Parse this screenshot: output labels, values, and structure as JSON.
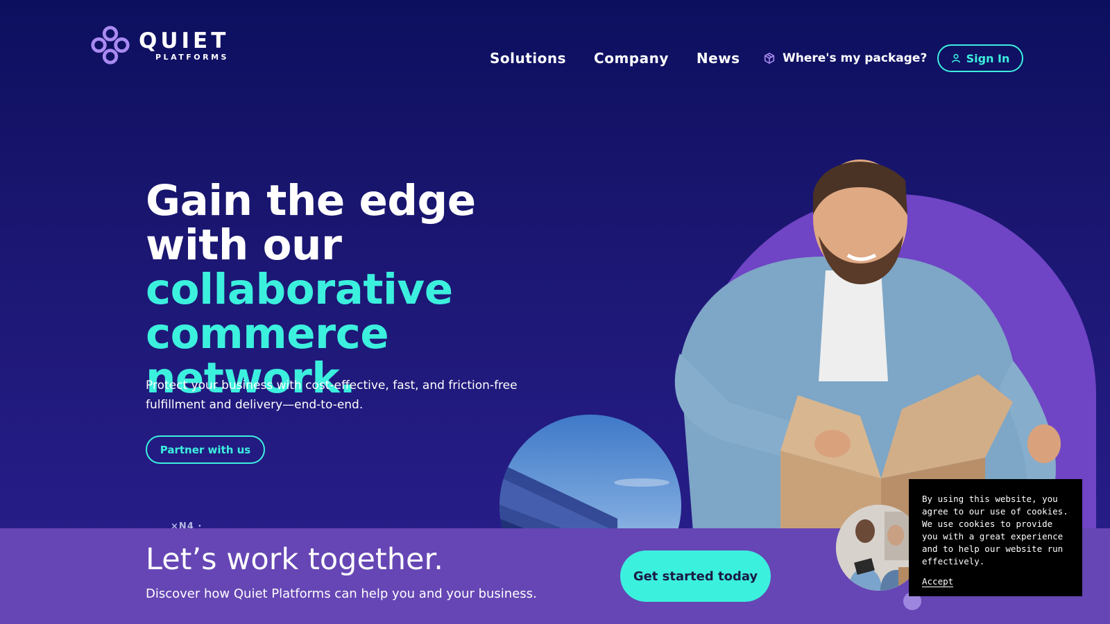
{
  "header": {
    "logo": {
      "word": "QUIET",
      "sub": "PLATFORMS"
    },
    "nav": [
      {
        "label": "Solutions"
      },
      {
        "label": "Company"
      },
      {
        "label": "News"
      }
    ],
    "track_label": "Where's my package?",
    "track_icon": "package-icon",
    "signin_label": "Sign In",
    "signin_icon": "user-icon"
  },
  "hero": {
    "headline_part1": "Gain the edge with our ",
    "headline_accent": "collaborative commerce network.",
    "subtext": "Protect your business with cost-effective, fast, and friction-free fulfillment and delivery—end-to-end.",
    "partner_label": "Partner with us",
    "partial_logo_text": "×N4 ·"
  },
  "cta": {
    "title": "Let’s work together.",
    "description": "Discover how Quiet Platforms can help you and your business.",
    "button_label": "Get started today"
  },
  "cookie": {
    "text": "By using this website, you agree to our use of cookies. We use cookies to provide you with a great experience and to help our website run effectively.",
    "accept_label": "Accept"
  },
  "colors": {
    "background": "#0c0f5e",
    "accent": "#3cf0de",
    "purple": "#6646b4"
  }
}
